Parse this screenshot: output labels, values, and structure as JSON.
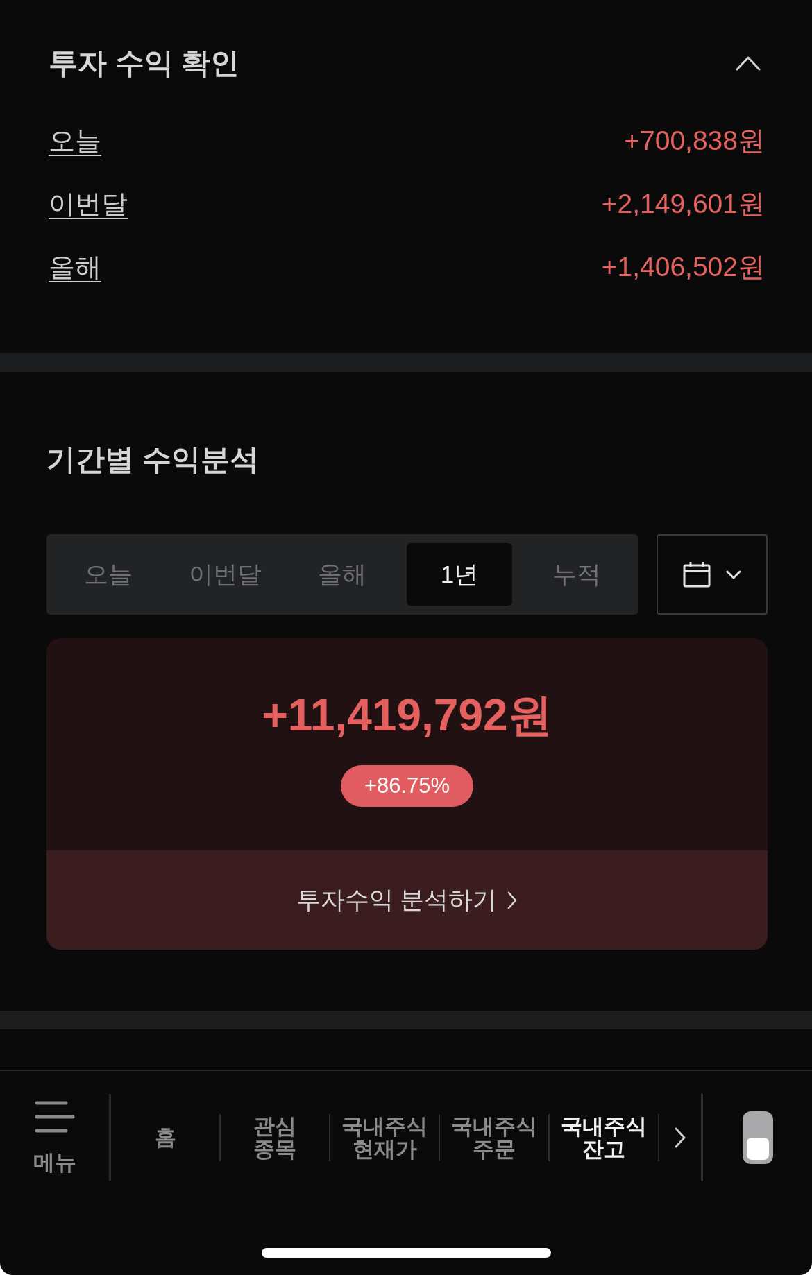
{
  "profit_summary": {
    "title": "투자 수익 확인",
    "expanded": true,
    "rows": [
      {
        "label": "오늘",
        "value": "+700,838원"
      },
      {
        "label": "이번달",
        "value": "+2,149,601원"
      },
      {
        "label": "올해",
        "value": "+1,406,502원"
      }
    ]
  },
  "period_analysis": {
    "title": "기간별 수익분석",
    "tabs": [
      {
        "label": "오늘",
        "selected": false
      },
      {
        "label": "이번달",
        "selected": false
      },
      {
        "label": "올해",
        "selected": false
      },
      {
        "label": "1년",
        "selected": true
      },
      {
        "label": "누적",
        "selected": false
      }
    ],
    "total_profit": "+11,419,792원",
    "return_rate": "+86.75%",
    "analyze_link": "투자수익 분석하기"
  },
  "bottom_nav": {
    "menu_label": "메뉴",
    "items": [
      {
        "label": "홈",
        "selected": false
      },
      {
        "label": "관심\n종목",
        "selected": false
      },
      {
        "label": "국내주식\n현재가",
        "selected": false
      },
      {
        "label": "국내주식\n주문",
        "selected": false
      },
      {
        "label": "국내주식\n잔고",
        "selected": true
      }
    ]
  }
}
